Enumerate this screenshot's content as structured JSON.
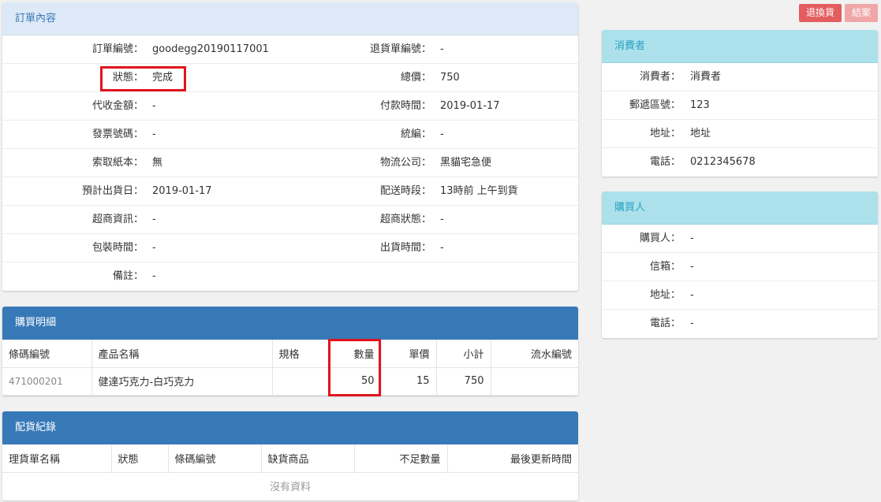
{
  "actions": {
    "return_label": "退換貨",
    "close_label": "結案",
    "accent": "#e35d60",
    "accent_faded": "#f0a6a7"
  },
  "order": {
    "title": "訂單內容",
    "rows": [
      {
        "l1": "訂單編號：",
        "v1": "goodegg20190117001",
        "l2": "退貨單編號：",
        "v2": "-"
      },
      {
        "l1": "狀態：",
        "v1": "完成",
        "l2": "總價：",
        "v2": "750"
      },
      {
        "l1": "代收金額：",
        "v1": "-",
        "l2": "付款時間：",
        "v2": "2019-01-17"
      },
      {
        "l1": "發票號碼：",
        "v1": "-",
        "l2": "統編：",
        "v2": "-"
      },
      {
        "l1": "索取紙本：",
        "v1": "無",
        "l2": "物流公司：",
        "v2": "黑貓宅急便"
      },
      {
        "l1": "預計出貨日：",
        "v1": "2019-01-17",
        "l2": "配送時段：",
        "v2": "13時前 上午到貨"
      },
      {
        "l1": "超商資訊：",
        "v1": "-",
        "l2": "超商狀態：",
        "v2": "-"
      },
      {
        "l1": "包裝時間：",
        "v1": "-",
        "l2": "出貨時間：",
        "v2": "-"
      },
      {
        "l1": "備註：",
        "v1": "-",
        "l2": "",
        "v2": ""
      }
    ]
  },
  "purchase": {
    "title": "購買明細",
    "headers": [
      "條碼編號",
      "產品名稱",
      "規格",
      "數量",
      "單價",
      "小計",
      "流水編號"
    ],
    "rows": [
      [
        "471000201",
        "健達巧克力-白巧克力",
        "",
        "50",
        "15",
        "750",
        ""
      ]
    ]
  },
  "allocation": {
    "title": "配貨紀錄",
    "headers": [
      "理貨單名稱",
      "狀態",
      "條碼編號",
      "缺貨商品",
      "不足數量",
      "最後更新時間"
    ],
    "empty_text": "沒有資料"
  },
  "consumer": {
    "title": "消費者",
    "rows": [
      {
        "label": "消費者：",
        "value": "消費者"
      },
      {
        "label": "郵遞區號：",
        "value": "123"
      },
      {
        "label": "地址：",
        "value": "地址"
      },
      {
        "label": "電話：",
        "value": "0212345678"
      }
    ]
  },
  "buyer": {
    "title": "購買人",
    "rows": [
      {
        "label": "購買人：",
        "value": "-"
      },
      {
        "label": "信箱：",
        "value": "-"
      },
      {
        "label": "地址：",
        "value": "-"
      },
      {
        "label": "電話：",
        "value": "-"
      }
    ]
  }
}
